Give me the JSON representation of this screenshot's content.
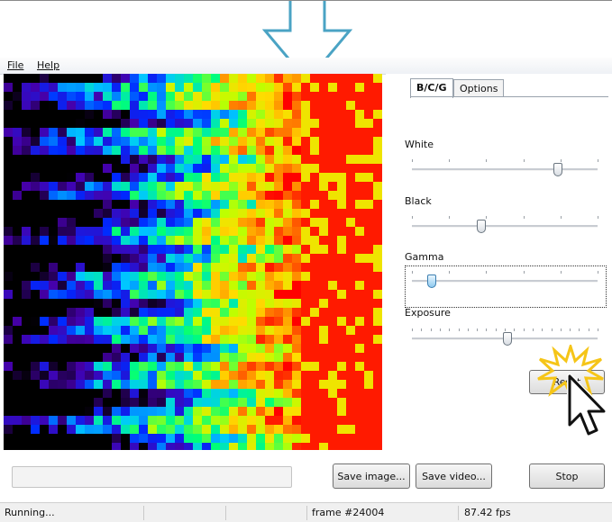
{
  "menu": {
    "file": "File",
    "help": "Help"
  },
  "tabs": {
    "bcg": "B/C/G",
    "options": "Options"
  },
  "sliders": [
    {
      "label": "White",
      "value": 0.78
    },
    {
      "label": "Black",
      "value": 0.37
    },
    {
      "label": "Gamma",
      "value": 0.1
    },
    {
      "label": "Exposure",
      "value": 0.51
    }
  ],
  "buttons": {
    "reset": "Reset",
    "save_image": "Save image...",
    "save_video": "Save video...",
    "stop": "Stop"
  },
  "status": {
    "state": "Running...",
    "frame": "frame #24004",
    "fps": "87.42 fps"
  },
  "colors": {
    "arrow": "#4aa3c4",
    "burst": "#f5c518",
    "focus_thumb": "#8fcaef"
  },
  "icons": {
    "annotation_arrow": "down-arrow-icon",
    "click_burst": "starburst-icon",
    "mouse_cursor": "mouse-pointer-icon"
  }
}
